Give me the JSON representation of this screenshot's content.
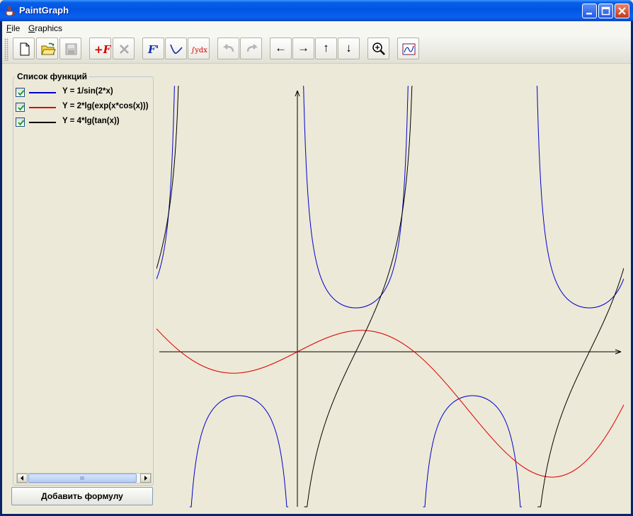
{
  "window": {
    "title": "PaintGraph",
    "app_icon": "java-cup-icon"
  },
  "menu": {
    "items": [
      {
        "label": "File",
        "mnemonic": "F"
      },
      {
        "label": "Graphics",
        "mnemonic": "G"
      }
    ]
  },
  "toolbar": {
    "buttons": [
      {
        "name": "new-file",
        "icon": "new-file-icon",
        "enabled": true
      },
      {
        "name": "open",
        "icon": "open-folder-icon",
        "enabled": true
      },
      {
        "name": "save",
        "icon": "save-disk-icon",
        "enabled": false
      },
      {
        "name": "add-function",
        "icon": "add-function-icon",
        "label": "+F",
        "enabled": true
      },
      {
        "name": "delete-function",
        "icon": "delete-x-icon",
        "enabled": false
      },
      {
        "name": "derivative",
        "icon": "derivative-icon",
        "label": "F'",
        "enabled": true
      },
      {
        "name": "extremum",
        "icon": "curve-icon",
        "enabled": true
      },
      {
        "name": "integral",
        "icon": "integral-icon",
        "label": "∫ydx",
        "enabled": true
      },
      {
        "name": "undo",
        "icon": "undo-arrow-icon",
        "enabled": false
      },
      {
        "name": "redo",
        "icon": "redo-arrow-icon",
        "enabled": false
      },
      {
        "name": "pan-left",
        "icon": "arrow-left-icon",
        "label": "←",
        "enabled": true
      },
      {
        "name": "pan-right",
        "icon": "arrow-right-icon",
        "label": "→",
        "enabled": true
      },
      {
        "name": "pan-up",
        "icon": "arrow-up-icon",
        "label": "↑",
        "enabled": true
      },
      {
        "name": "pan-down",
        "icon": "arrow-down-icon",
        "label": "↓",
        "enabled": true
      },
      {
        "name": "zoom",
        "icon": "zoom-in-icon",
        "enabled": true
      },
      {
        "name": "fit-graph",
        "icon": "fit-graph-icon",
        "enabled": true
      }
    ]
  },
  "panel": {
    "title": "Список функций",
    "functions": [
      {
        "label": "Y = 1/sin(2*x)",
        "checked": true,
        "color": "#0000cc"
      },
      {
        "label": "Y = 2*lg(exp(x*cos(x)))",
        "checked": true,
        "color": "#dd0000"
      },
      {
        "label": "Y = 4*lg(tan(x))",
        "checked": true,
        "color": "#000000"
      }
    ],
    "add_button_label": "Добавить формулу"
  },
  "colors": {
    "axis": "#000000",
    "plot_background": "#ece9d8"
  }
}
